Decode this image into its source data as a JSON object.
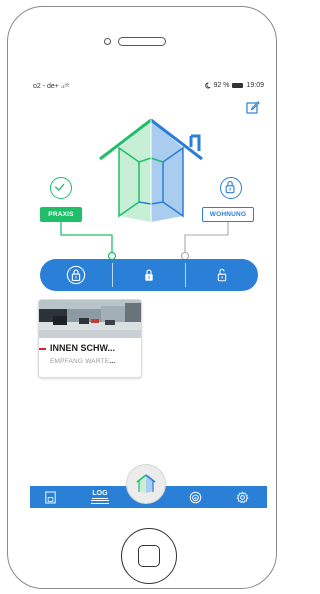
{
  "statusbar": {
    "carrier": "o2 - de+",
    "battery": "92 %",
    "time": "19:09"
  },
  "zones": {
    "left": {
      "label": "PRAXIS",
      "color": "#1fbf6a",
      "state": "locked"
    },
    "right": {
      "label": "WOHNUNG",
      "color": "#2a7fd6",
      "state": "locked"
    }
  },
  "lockbar": {
    "color": "#2a7fd6",
    "buttons": [
      {
        "icon": "lock-closed-icon",
        "selected": true
      },
      {
        "icon": "lock-closed-icon",
        "selected": false
      },
      {
        "icon": "lock-open-icon",
        "selected": false
      }
    ]
  },
  "camera": {
    "title": "INNEN SCHW...",
    "subtitle": "EMPFANG WARTE",
    "subtitle_suffix": "..."
  },
  "nav": {
    "log_label": "LOG",
    "items": [
      "document-icon",
      "log-icon",
      "home-icon",
      "camera-icon",
      "gear-icon"
    ]
  },
  "icons": {
    "edit": "edit-icon",
    "check": "check-icon",
    "house": "house-icon"
  }
}
